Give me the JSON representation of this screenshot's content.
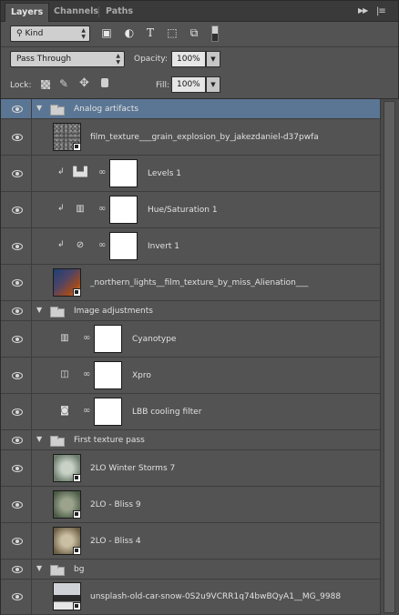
{
  "tabs": [
    "Layers",
    "Channels",
    "Paths"
  ],
  "active_tab": "Layers",
  "panel_menu": "▸▸ | ≡",
  "filter": {
    "kind_label": "Kind"
  },
  "blend": {
    "mode": "Pass Through",
    "opacity_label": "Opacity:",
    "opacity_value": "100%"
  },
  "lock": {
    "label": "Lock:",
    "fill_label": "Fill:",
    "fill_value": "100%"
  },
  "layers": [
    {
      "name": "Analog artifacts"
    },
    {
      "name": "film_texture___grain_explosion_by_jakezdaniel-d37pwfa"
    },
    {
      "name": "Levels 1"
    },
    {
      "name": "Hue/Saturation 1"
    },
    {
      "name": "Invert 1"
    },
    {
      "name": "_northern_lights__film_texture_by_miss_Alienation___"
    },
    {
      "name": "Image adjustments"
    },
    {
      "name": "Cyanotype"
    },
    {
      "name": "Xpro"
    },
    {
      "name": "LBB cooling filter"
    },
    {
      "name": "First texture pass"
    },
    {
      "name": "2LO Winter Storms 7"
    },
    {
      "name": "2LO - Bliss 9"
    },
    {
      "name": "2LO - Bliss 4"
    },
    {
      "name": "bg"
    },
    {
      "name": "unsplash-old-car-snow-0S2u9VCRR1q74bwBQyA1__MG_9988"
    }
  ]
}
